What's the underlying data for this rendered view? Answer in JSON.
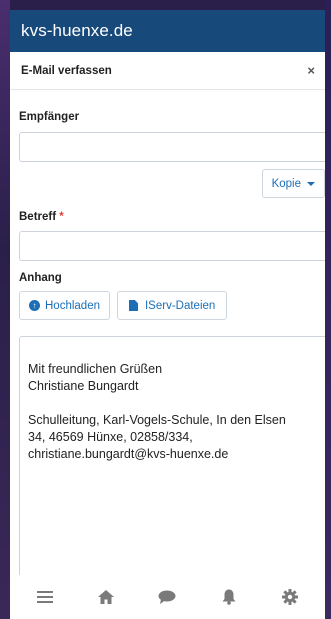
{
  "site_title": "kvs-huenxe.de",
  "modal": {
    "title": "E-Mail verfassen",
    "close_label": "×"
  },
  "form": {
    "recipient_label": "Empfänger",
    "recipient_value": "",
    "copy_button": "Kopie",
    "subject_label": "Betreff",
    "required_marker": "*",
    "subject_value": "",
    "attachment_label": "Anhang",
    "upload_button": "Hochladen",
    "iserv_files_button": "IServ-Dateien"
  },
  "body": {
    "greeting": "Mit freundlichen Grüßen",
    "name": "Christiane Bungardt",
    "signature_line1": "Schulleitung, Karl-Vogels-Schule, In den Elsen",
    "signature_line2": "34, 46569 Hünxe, 02858/334,",
    "signature_line3": "christiane.bungardt@kvs-huenxe.de"
  },
  "bottom_nav": [
    "menu-icon",
    "home-icon",
    "chat-icon",
    "bell-icon",
    "gear-icon"
  ],
  "colors": {
    "topbar": "#17497a",
    "accent": "#1c6fb6",
    "required": "#e0403a"
  }
}
